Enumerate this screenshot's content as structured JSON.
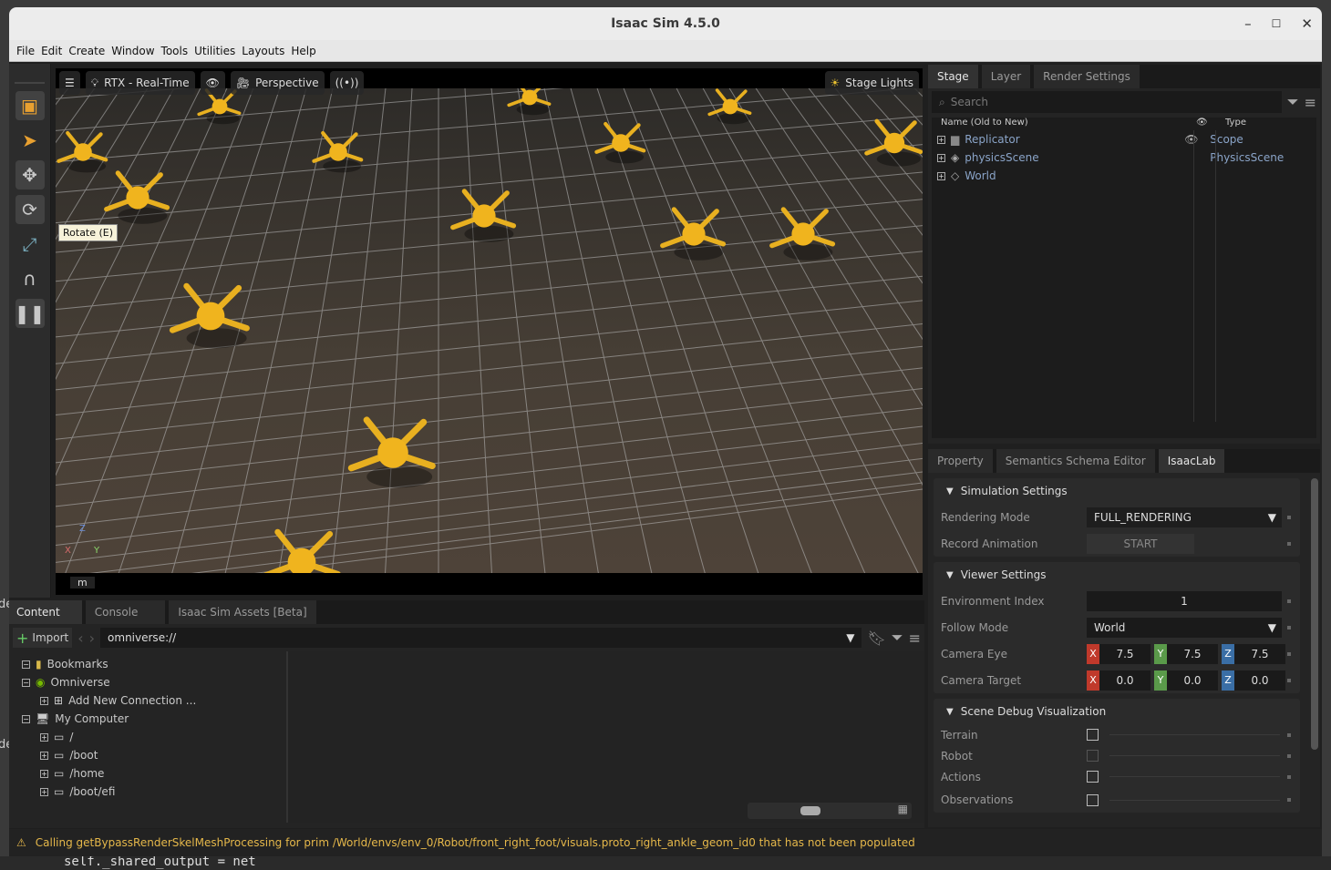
{
  "window": {
    "title": "Isaac Sim 4.5.0",
    "minimize": "–",
    "maximize": "☐",
    "close": "✕"
  },
  "menu": [
    "File",
    "Edit",
    "Create",
    "Window",
    "Tools",
    "Utilities",
    "Layouts",
    "Help"
  ],
  "viewport": {
    "render_mode": "RTX - Real-Time",
    "camera": "Perspective",
    "lights": "Stage Lights",
    "tooltip": "Rotate (E)",
    "footer_key": "m",
    "axes": {
      "x": "X",
      "y": "Y",
      "z": "Z"
    }
  },
  "stage": {
    "tabs": [
      "Stage",
      "Layer",
      "Render Settings"
    ],
    "search_placeholder": "Search",
    "col_name": "Name (Old to New)",
    "col_type": "Type",
    "items": [
      {
        "name": "Replicator",
        "type": "Scope"
      },
      {
        "name": "physicsScene",
        "type": "PhysicsScene"
      },
      {
        "name": "World",
        "type": ""
      }
    ]
  },
  "property": {
    "tabs": [
      "Property",
      "Semantics Schema Editor",
      "IsaacLab"
    ],
    "sim_settings": {
      "title": "Simulation Settings",
      "rendering_mode_label": "Rendering Mode",
      "rendering_mode_value": "FULL_RENDERING",
      "record_label": "Record Animation",
      "record_button": "START"
    },
    "viewer_settings": {
      "title": "Viewer Settings",
      "env_index_label": "Environment Index",
      "env_index_value": "1",
      "follow_mode_label": "Follow Mode",
      "follow_mode_value": "World",
      "camera_eye_label": "Camera Eye",
      "camera_eye": [
        "7.5",
        "7.5",
        "7.5"
      ],
      "camera_target_label": "Camera Target",
      "camera_target": [
        "0.0",
        "0.0",
        "0.0"
      ],
      "x": "X",
      "y": "Y",
      "z": "Z"
    },
    "debug": {
      "title": "Scene Debug Visualization",
      "items": [
        "Terrain",
        "Robot",
        "Actions",
        "Observations"
      ]
    }
  },
  "content": {
    "tabs": [
      "Content",
      "Console",
      "Isaac Sim Assets [Beta]"
    ],
    "import": "Import",
    "path": "omniverse://",
    "tree": [
      {
        "label": "Bookmarks",
        "level": 0
      },
      {
        "label": "Omniverse",
        "level": 0
      },
      {
        "label": "Add New Connection ...",
        "level": 1
      },
      {
        "label": "My Computer",
        "level": 0
      },
      {
        "label": "/",
        "level": 1
      },
      {
        "label": "/boot",
        "level": 1
      },
      {
        "label": "/home",
        "level": 1
      },
      {
        "label": "/boot/efi",
        "level": 1
      }
    ]
  },
  "status": "Calling getBypassRenderSkelMeshProcessing for prim /World/envs/env_0/Robot/front_right_foot/visuals.proto_right_ankle_geom_id0 that has not been populated",
  "terminal_line": "self._shared_output = net",
  "terminal_left": "de"
}
